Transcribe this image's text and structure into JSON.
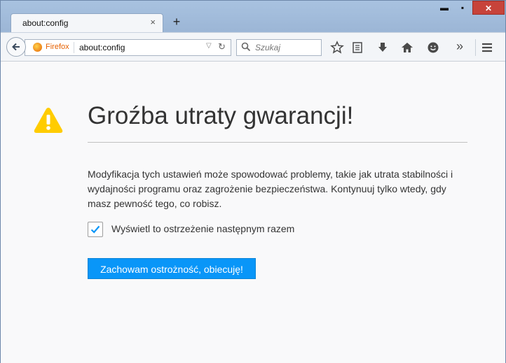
{
  "window": {
    "minimize": "▬",
    "maximize": "▪",
    "close": "✕"
  },
  "tab": {
    "title": "about:config",
    "close": "×",
    "new_tab": "+"
  },
  "navbar": {
    "identity_label": "Firefox",
    "url": "about:config",
    "search_placeholder": "Szukaj",
    "overflow": "»"
  },
  "page": {
    "heading": "Groźba utraty gwarancji!",
    "warning": "Modyfikacja tych ustawień może spowodować problemy, takie jak utrata stabilności i wydajności programu oraz zagrożenie bezpieczeństwa. Kontynuuj tylko wtedy, gdy masz pewność tego, co robisz.",
    "checkbox_label": "Wyświetl to ostrzeżenie następnym razem",
    "checkbox_checked": true,
    "accept_button": "Zachowam ostrożność, obiecuję!"
  },
  "colors": {
    "accent": "#0996f8",
    "warning": "#ffcc00",
    "firefox": "#e66000",
    "close": "#c7433a"
  }
}
